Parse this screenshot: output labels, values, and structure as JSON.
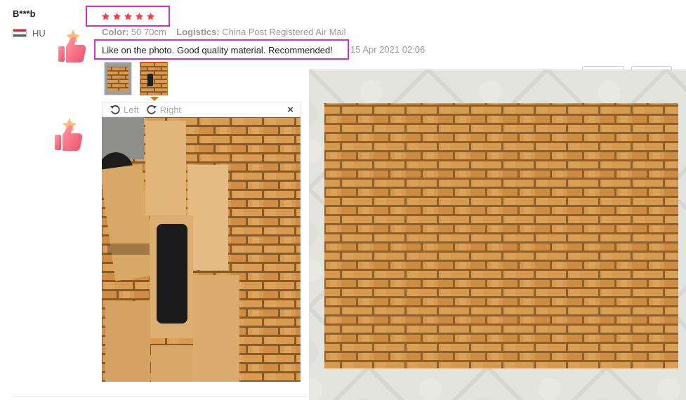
{
  "review": {
    "reviewer_name": "B***b",
    "country_code": "HU",
    "rating": 5,
    "color_label": "Color:",
    "color_value": "50 70cm",
    "logistics_label": "Logistics:",
    "logistics_value": "China Post Registered Air Mail",
    "feedback_text": "Like on the photo. Good quality material. Recommended!",
    "date": "15 Apr 2021 02:06"
  },
  "viewer": {
    "rotate_left_label": "Left",
    "rotate_right_label": "Right",
    "close_symbol": "×",
    "thumbnail_count": 2,
    "selected_thumbnail": 2
  },
  "icons": {
    "thumbs_up": "thumbs-up-icon",
    "rotate_left": "rotate-left-icon",
    "rotate_right": "rotate-right-icon",
    "star": "star-icon",
    "flag": "hungary-flag-icon"
  },
  "colors": {
    "star": "#f0444a",
    "highlight_border": "#cc33cc",
    "thumbnail_selected": "#e07a10",
    "flag_red": "#cd2a3e",
    "flag_white": "#ffffff",
    "flag_green": "#436f4d",
    "thumbs_up": "#f06a7a"
  }
}
